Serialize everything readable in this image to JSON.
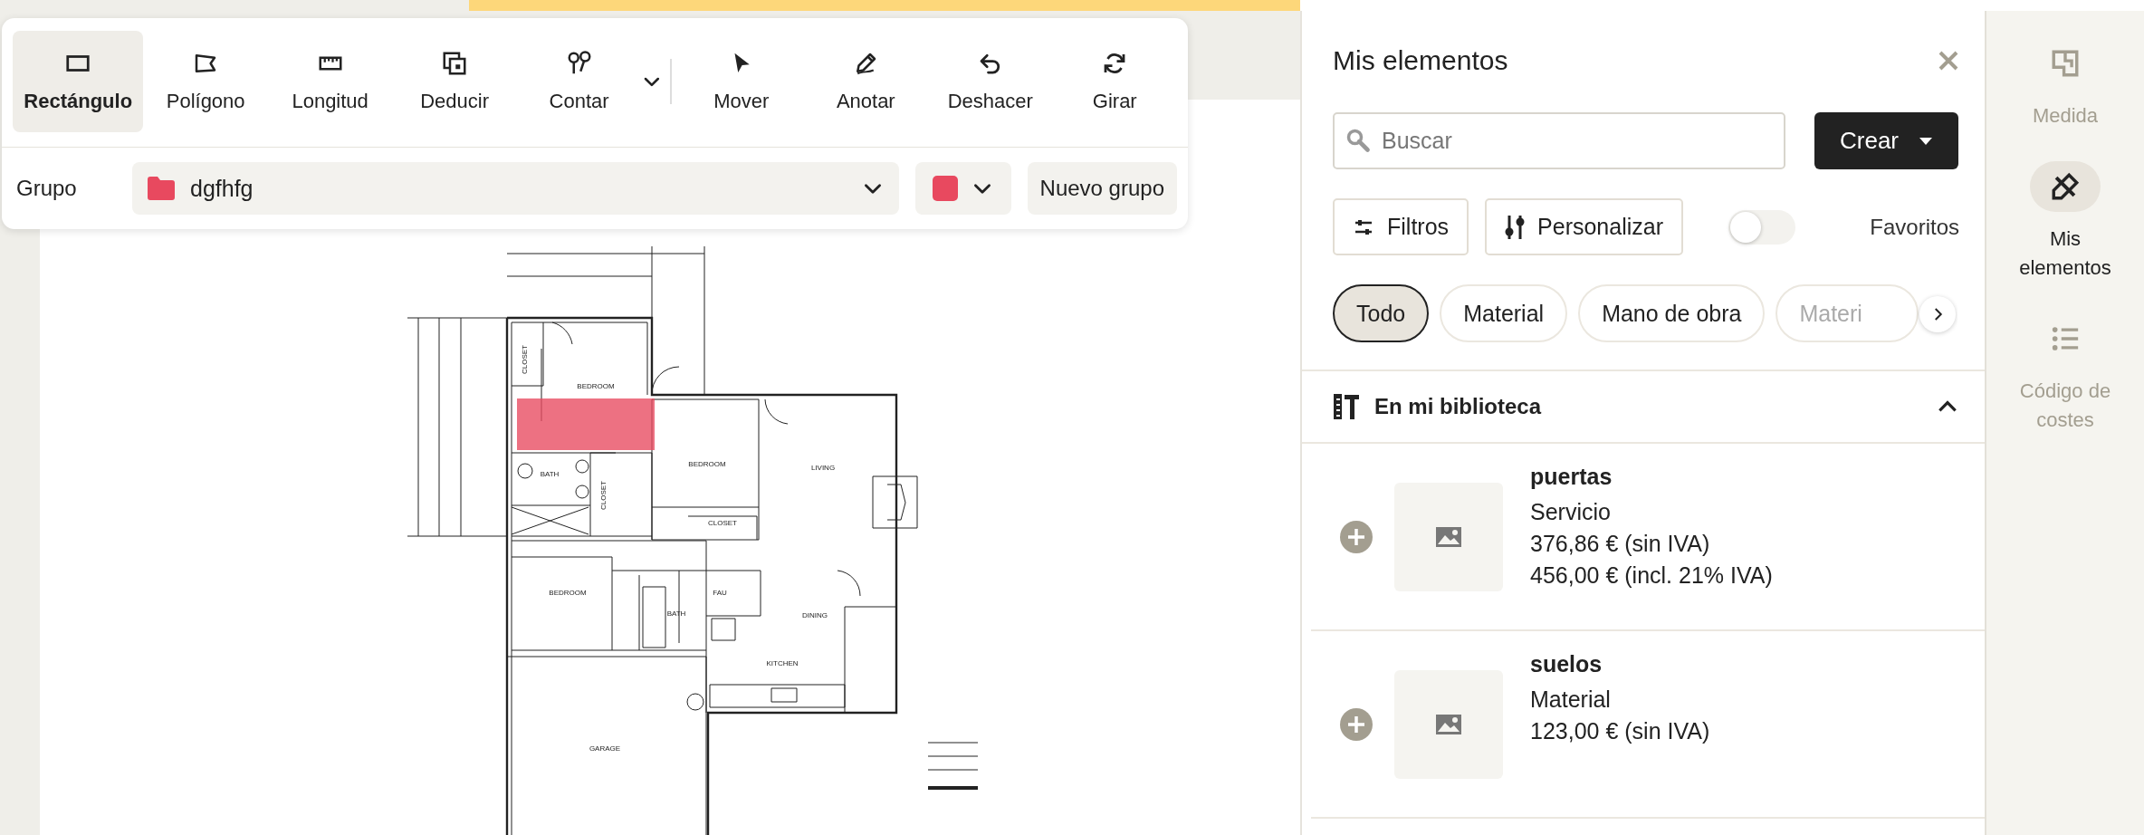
{
  "toolbar": {
    "tools": [
      {
        "label": "Rectángulo",
        "selected": true
      },
      {
        "label": "Polígono",
        "selected": false
      },
      {
        "label": "Longitud",
        "selected": false
      },
      {
        "label": "Deducir",
        "selected": false
      },
      {
        "label": "Contar",
        "selected": false
      },
      {
        "label": "Mover",
        "selected": false
      },
      {
        "label": "Anotar",
        "selected": false
      },
      {
        "label": "Deshacer",
        "selected": false
      },
      {
        "label": "Girar",
        "selected": false
      }
    ],
    "group": {
      "label": "Grupo",
      "name": "dgfhfg",
      "color": "#e8495f",
      "button": "Nuevo grupo"
    }
  },
  "plan": {
    "rooms": [
      "BEDROOM",
      "CLOSET",
      "BEDROOM",
      "LIVING",
      "BATH",
      "CLOSET",
      "CLOSET",
      "BEDROOM",
      "BATH",
      "FAU",
      "DINING",
      "KITCHEN",
      "GARAGE"
    ]
  },
  "panel": {
    "title": "Mis elementos",
    "search": {
      "placeholder": "Buscar"
    },
    "create": "Crear",
    "filters": "Filtros",
    "customize": "Personalizar",
    "favorites": {
      "label": "Favoritos",
      "on": false
    },
    "chips": [
      {
        "label": "Todo",
        "selected": true
      },
      {
        "label": "Material",
        "selected": false
      },
      {
        "label": "Mano de obra",
        "selected": false
      },
      {
        "label": "Materi",
        "selected": false
      }
    ],
    "library": {
      "title": "En mi biblioteca",
      "expanded": true,
      "items": [
        {
          "name": "puertas",
          "type": "Servicio",
          "prices": [
            "376,86 € (sin IVA)",
            "456,00 € (incl. 21% IVA)"
          ]
        },
        {
          "name": "suelos",
          "type": "Material",
          "prices": [
            "123,00 € (sin IVA)"
          ]
        }
      ]
    }
  },
  "rail": [
    {
      "label": "Medida",
      "selected": false
    },
    {
      "label": "Mis elementos",
      "selected": true
    },
    {
      "label": "Código de costes",
      "selected": false
    }
  ]
}
